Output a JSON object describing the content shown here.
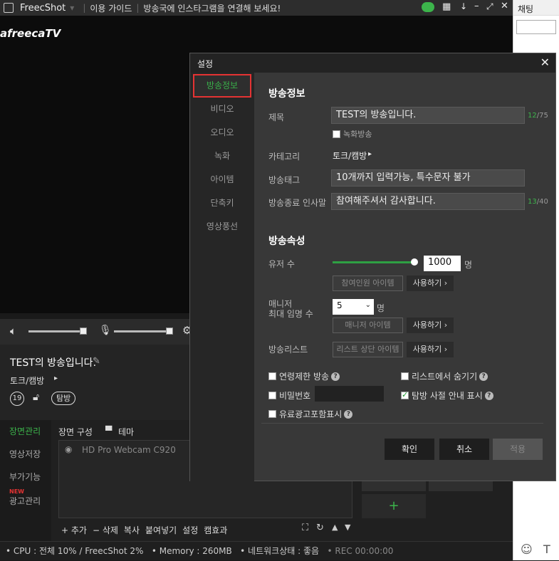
{
  "titlebar": {
    "app_name": "FreecShot",
    "guide": "이용 가이드",
    "notice": "방송국에 인스타그램을 연결해 보세요!"
  },
  "preview": {
    "logo": "afreecaTV"
  },
  "chat": {
    "title": "채팅"
  },
  "info": {
    "title": "TEST의 방송입니다.",
    "category": "토크/캠방",
    "age_badge": "19",
    "tag_badge": "탐방"
  },
  "left_nav": [
    "장면관리",
    "영상저장",
    "부가기능",
    "광고관리"
  ],
  "left_nav_new": "NEW",
  "scene": {
    "tab1": "장면 구성",
    "tab2": "테마",
    "source": "HD Pro Webcam C920",
    "toolbar": [
      "+ 추가",
      "− 삭제",
      "복사",
      "붙여넣기",
      "설정",
      "캠효과"
    ]
  },
  "statusbar": {
    "cpu": "• CPU : 전체 10% / FreecShot 2%",
    "memory": "• Memory : 260MB",
    "network": "• 네트워크상태 : 좋음",
    "rec": "• REC 00:00:00"
  },
  "dialog": {
    "title": "설정",
    "nav": [
      "방송정보",
      "비디오",
      "오디오",
      "녹화",
      "아이템",
      "단축키",
      "영상풍선"
    ],
    "section1": "방송정보",
    "title_label": "제목",
    "title_value": "TEST의 방송입니다.",
    "title_count": "12",
    "title_max": "/75",
    "record_label": "녹화방송",
    "category_label": "카테고리",
    "category_value": "토크/캠방",
    "tag_label": "방송태그",
    "tag_value": "10개까지 입력가능, 특수문자 불가",
    "end_label": "방송종료 인사말",
    "end_value": "참여해주셔서 감사합니다.",
    "end_count": "13",
    "end_max": "/40",
    "section2": "방송속성",
    "viewers_label": "유저 수",
    "viewers_value": "1000",
    "viewers_unit": "명",
    "viewers_slider": 1.0,
    "participant_item": "참여인원 아이템",
    "use": "사용하기 ›",
    "manager_label1": "매니저",
    "manager_label2": "최대 임명 수",
    "manager_value": "5",
    "manager_unit": "명",
    "manager_item": "매니저 아이템",
    "list_label": "방송리스트",
    "list_item": "리스트 상단 아이템",
    "age_limit": "연령제한 방송",
    "hide_list": "리스트에서 숨기기",
    "password": "비밀번호",
    "tambang": "탐방 사절 안내 표시",
    "paid_ad": "유료광고포함표시",
    "ok": "확인",
    "cancel": "취소",
    "apply": "적용"
  }
}
